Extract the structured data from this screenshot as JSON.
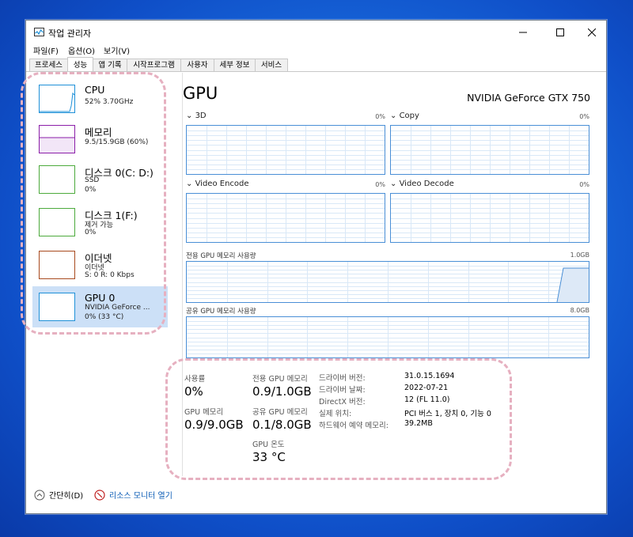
{
  "window": {
    "title": "작업 관리자",
    "menu": [
      "파일(F)",
      "옵션(O)",
      "보기(V)"
    ],
    "tabs": [
      "프로세스",
      "성능",
      "앱 기록",
      "시작프로그램",
      "사용자",
      "세부 정보",
      "서비스"
    ],
    "active_tab": 1
  },
  "sidebar": {
    "items": [
      {
        "name": "CPU",
        "sub1": "52% 3.70GHz",
        "sub2": "",
        "color": "#1e90d8"
      },
      {
        "name": "메모리",
        "sub1": "9.5/15.9GB (60%)",
        "sub2": "",
        "color": "#8b1ea8"
      },
      {
        "name": "디스크 0(C: D:)",
        "sub1": "SSD",
        "sub2": "0%",
        "color": "#4caa3c"
      },
      {
        "name": "디스크 1(F:)",
        "sub1": "제거 가능",
        "sub2": "0%",
        "color": "#4caa3c"
      },
      {
        "name": "이더넷",
        "sub1": "이더넷",
        "sub2": "S: 0  R: 0 Kbps",
        "color": "#a84a1e"
      },
      {
        "name": "GPU 0",
        "sub1": "NVIDIA GeForce ...",
        "sub2": "0% (33 °C)",
        "color": "#1e90d8"
      }
    ]
  },
  "main": {
    "title": "GPU",
    "model": "NVIDIA GeForce GTX 750",
    "engines": [
      {
        "label": "3D",
        "pct": "0%"
      },
      {
        "label": "Copy",
        "pct": "0%"
      },
      {
        "label": "Video Encode",
        "pct": "0%"
      },
      {
        "label": "Video Decode",
        "pct": "0%"
      }
    ],
    "dedicated_mem": {
      "label": "전용 GPU 메모리 사용량",
      "max": "1.0GB"
    },
    "shared_mem": {
      "label": "공유 GPU 메모리 사용량",
      "max": "8.0GB"
    },
    "stats": {
      "usage": {
        "label": "사용률",
        "value": "0%"
      },
      "dedicated": {
        "label": "전용 GPU 메모리",
        "value": "0.9/1.0GB"
      },
      "gpu_mem": {
        "label": "GPU 메모리",
        "value": "0.9/9.0GB"
      },
      "shared": {
        "label": "공유 GPU 메모리",
        "value": "0.1/8.0GB"
      },
      "temp": {
        "label": "GPU 온도",
        "value": "33 °C"
      }
    },
    "info": [
      {
        "key": "드라이버 버전:",
        "value": "31.0.15.1694"
      },
      {
        "key": "드라이버 날짜:",
        "value": "2022-07-21"
      },
      {
        "key": "DirectX 버전:",
        "value": "12 (FL 11.0)"
      },
      {
        "key": "실제 위치:",
        "value": "PCI 버스 1, 장치 0, 기능 0"
      },
      {
        "key": "하드웨어 예약 메모리:",
        "value": "39.2MB"
      }
    ]
  },
  "footer": {
    "fewer_details": "간단히(D)",
    "resource_monitor": "리소스 모니터 열기"
  }
}
